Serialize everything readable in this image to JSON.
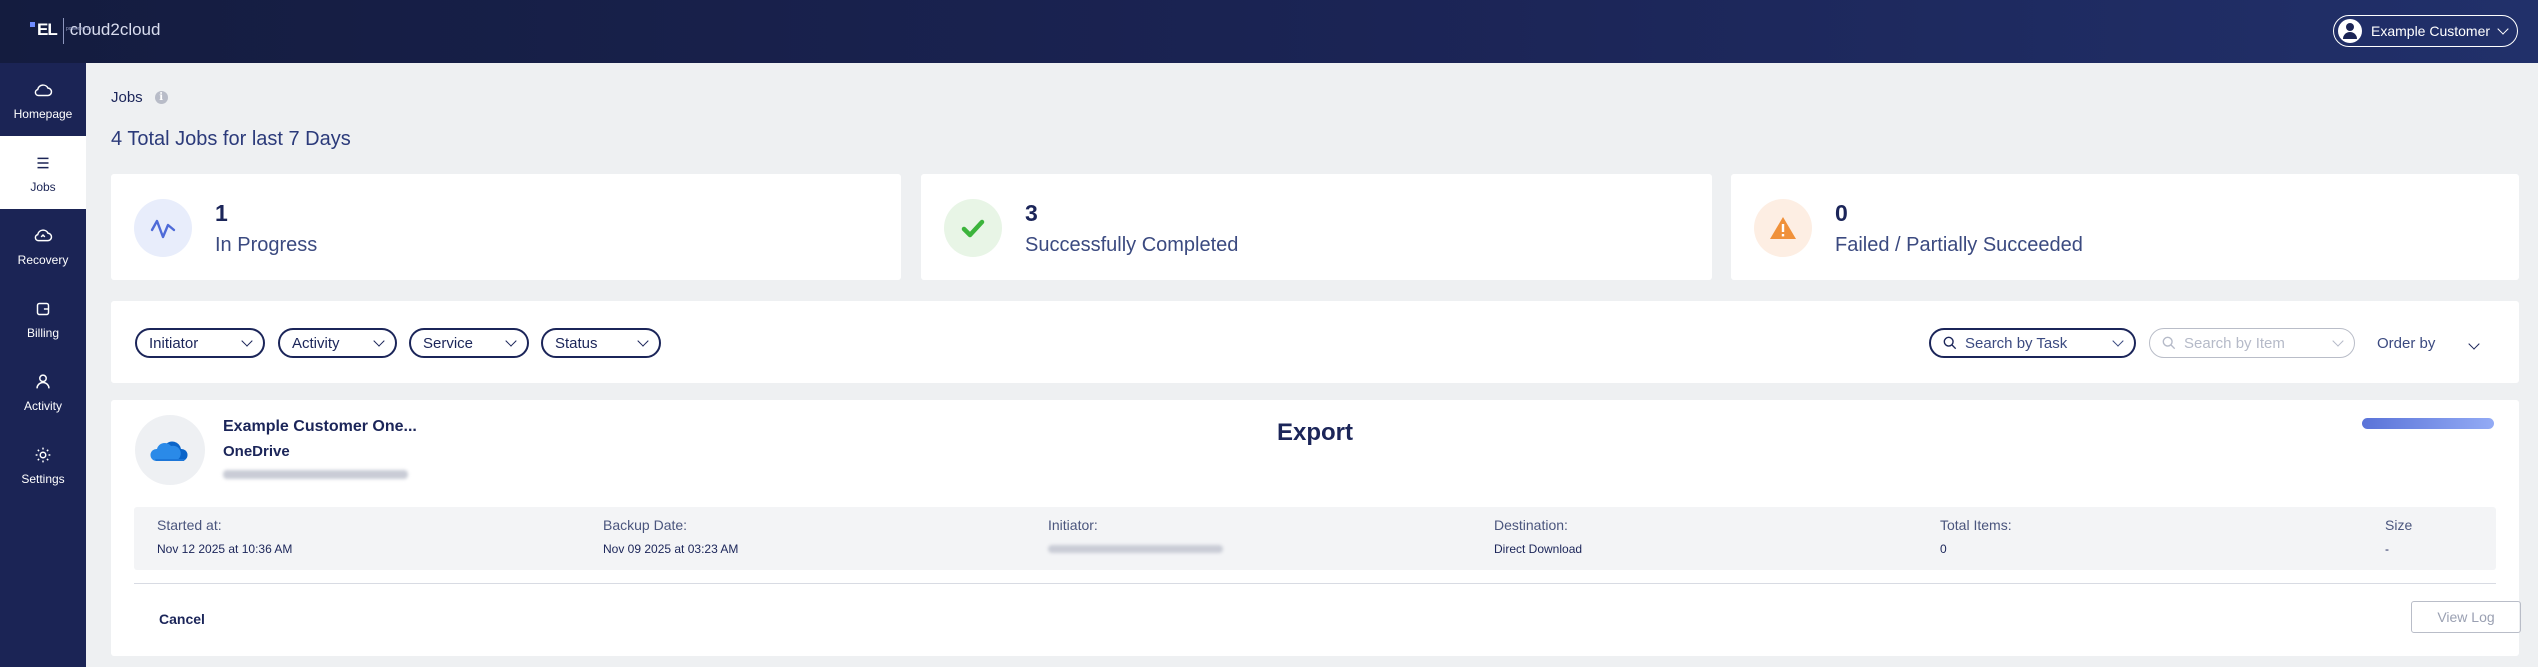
{
  "header": {
    "logo_mark": "EL",
    "logo_text": "cloud2cloud",
    "logo_sub": "powered by",
    "user_name": "Example Customer"
  },
  "sidebar": {
    "items": [
      {
        "label": "Homepage",
        "icon": "cloud-icon",
        "active": false
      },
      {
        "label": "Jobs",
        "icon": "list-icon",
        "active": true
      },
      {
        "label": "Recovery",
        "icon": "cloud-restore-icon",
        "active": false
      },
      {
        "label": "Billing",
        "icon": "wallet-icon",
        "active": false
      },
      {
        "label": "Activity",
        "icon": "user-icon",
        "active": false
      },
      {
        "label": "Settings",
        "icon": "gear-icon",
        "active": false
      }
    ]
  },
  "page": {
    "title": "Jobs",
    "summary": "4 Total Jobs for last 7 Days"
  },
  "stats": [
    {
      "value": "1",
      "label": "In Progress",
      "icon": "activity-icon",
      "color": "#4f6bd8"
    },
    {
      "value": "3",
      "label": "Successfully Completed",
      "icon": "checkmark-icon",
      "color": "#3cb43c"
    },
    {
      "value": "0",
      "label": "Failed / Partially Succeeded",
      "icon": "warning-icon",
      "color": "#f0913a"
    }
  ],
  "filters": {
    "initiator": "Initiator",
    "activity": "Activity",
    "service": "Service",
    "status": "Status",
    "search_task_placeholder": "Search by Task",
    "search_item_placeholder": "Search by Item",
    "order_by": "Order by"
  },
  "job": {
    "name": "Example Customer One...",
    "service": "OneDrive",
    "type": "Export",
    "progress": 1.0,
    "details": [
      {
        "label": "Started at:",
        "value": "Nov 12 2025 at 10:36 AM"
      },
      {
        "label": "Backup Date:",
        "value": "Nov 09 2025 at 03:23 AM"
      },
      {
        "label": "Initiator:",
        "value": ""
      },
      {
        "label": "Destination:",
        "value": "Direct Download"
      },
      {
        "label": "Total Items:",
        "value": "0"
      },
      {
        "label": "Size",
        "value": "-"
      }
    ],
    "cancel_label": "Cancel",
    "view_log_label": "View Log"
  }
}
